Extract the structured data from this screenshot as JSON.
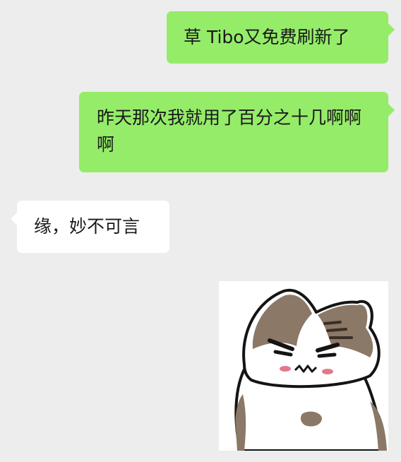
{
  "messages": [
    {
      "side": "sent",
      "text": "草 Tibo又免费刷新了"
    },
    {
      "side": "sent",
      "text": "昨天那次我就用了百分之十几啊啊啊"
    },
    {
      "side": "received",
      "text": "缘，妙不可言"
    },
    {
      "side": "sent",
      "type": "sticker",
      "sticker": "cat-sticker"
    }
  ],
  "colors": {
    "background": "#ededed",
    "sent_bubble": "#95ec69",
    "received_bubble": "#ffffff",
    "text": "#191919"
  }
}
